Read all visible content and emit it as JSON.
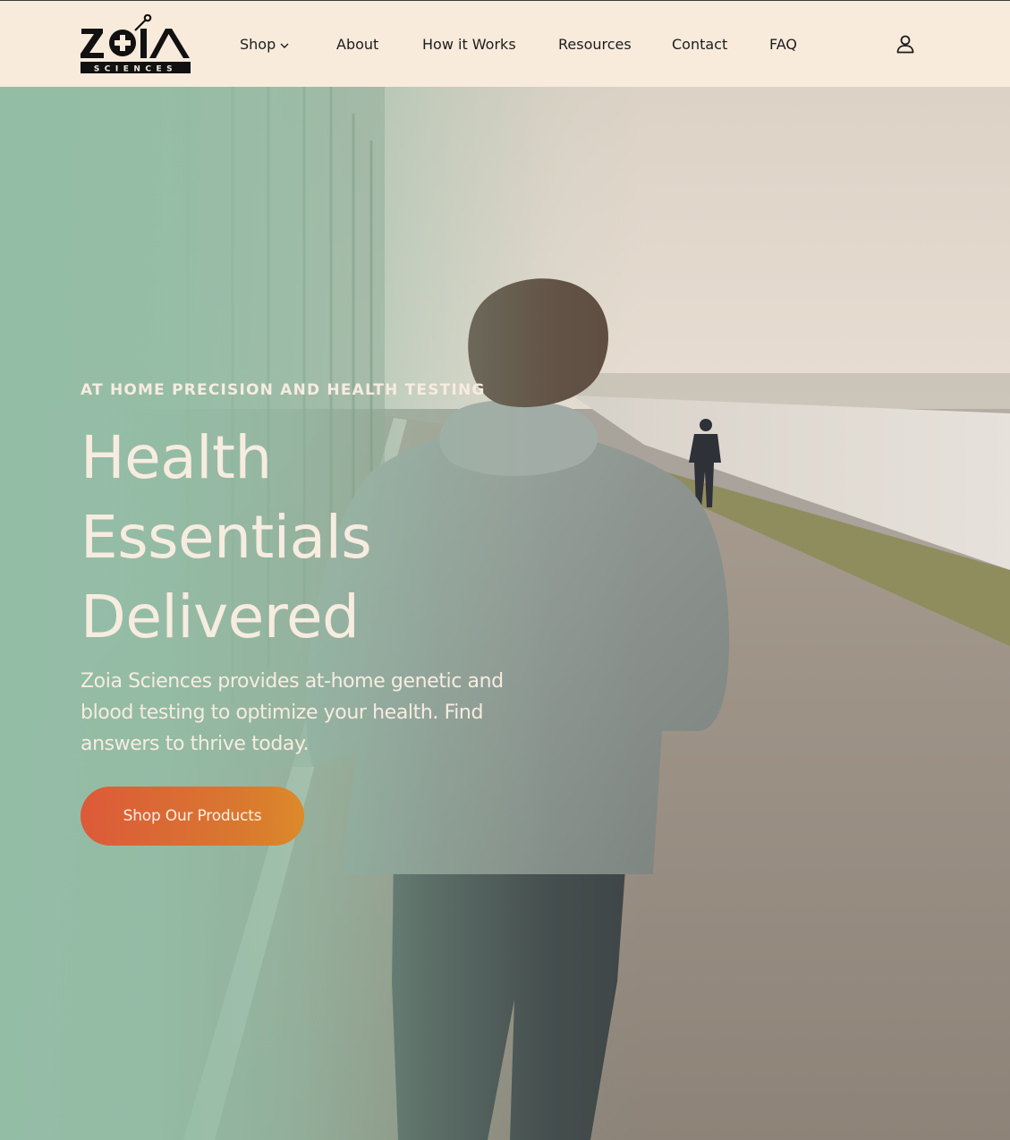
{
  "brand": {
    "name": "ZOIA",
    "subtitle": "SCIENCES"
  },
  "nav": {
    "items": [
      {
        "label": "Shop",
        "has_dropdown": true
      },
      {
        "label": "About"
      },
      {
        "label": "How it Works"
      },
      {
        "label": "Resources"
      },
      {
        "label": "Contact"
      },
      {
        "label": "FAQ"
      }
    ],
    "account_icon": "user-icon"
  },
  "hero": {
    "eyebrow": "AT HOME PRECISION AND HEALTH TESTING",
    "headline_lines": [
      "Health",
      "Essentials",
      "Delivered"
    ],
    "description": "Zoia Sciences provides at-home genetic and blood testing to optimize your health. Find answers to thrive today.",
    "cta_label": "Shop Our Products"
  },
  "colors": {
    "header_bg": "#f8ebdc",
    "overlay_green": "#94bda6",
    "hero_text": "#f7ece0",
    "cta_start": "#dc5a39",
    "cta_end": "#dc8a2a",
    "nav_text": "#1d1d1d"
  }
}
